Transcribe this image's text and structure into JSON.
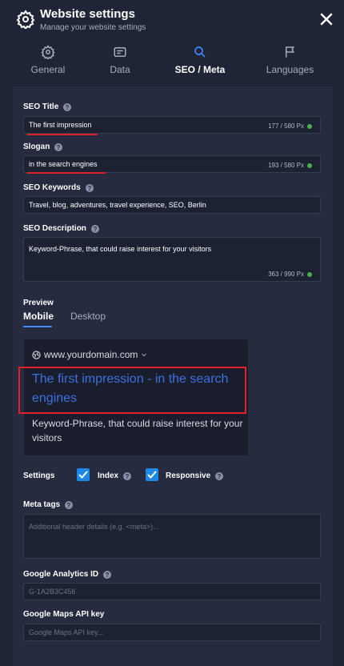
{
  "header": {
    "title": "Website settings",
    "subtitle": "Manage your website settings"
  },
  "tabs": [
    {
      "label": "General",
      "icon": "gear-icon"
    },
    {
      "label": "Data",
      "icon": "database-icon"
    },
    {
      "label": "SEO / Meta",
      "icon": "search-icon",
      "active": true
    },
    {
      "label": "Languages",
      "icon": "flag-icon"
    }
  ],
  "seo": {
    "title_label": "SEO Title",
    "title_value": "The first impression",
    "title_counter": "177 / 580 Px",
    "slogan_label": "Slogan",
    "slogan_value": "in the search engines",
    "slogan_counter": "193 / 580 Px",
    "keywords_label": "SEO Keywords",
    "keywords_value": "Travel, blog, adventures, travel experience, SEO, Berlin",
    "description_label": "SEO Description",
    "description_value": "Keyword-Phrase, that could raise interest for your visitors",
    "description_counter": "363 / 990 Px"
  },
  "preview": {
    "label": "Preview",
    "tab_mobile": "Mobile",
    "tab_desktop": "Desktop",
    "domain": "www.yourdomain.com",
    "title": "The first impression - in the search engines",
    "description": "Keyword-Phrase, that could raise interest for your visitors"
  },
  "settings": {
    "label": "Settings",
    "index_label": "Index",
    "index_checked": true,
    "responsive_label": "Responsive",
    "responsive_checked": true
  },
  "meta_tags": {
    "label": "Meta tags",
    "placeholder": "Additional header details (e.g. <meta>)..."
  },
  "analytics": {
    "label": "Google Analytics ID",
    "placeholder": "G-1A2B3C456"
  },
  "maps": {
    "label": "Google Maps API key",
    "placeholder": "Google Maps API key..."
  },
  "colors": {
    "background": "#1f2437",
    "card": "#262b40",
    "accent": "#1e88e5",
    "link": "#3d6fe0",
    "annotation_red": "#e0202a",
    "ok_green": "#4caf50"
  }
}
